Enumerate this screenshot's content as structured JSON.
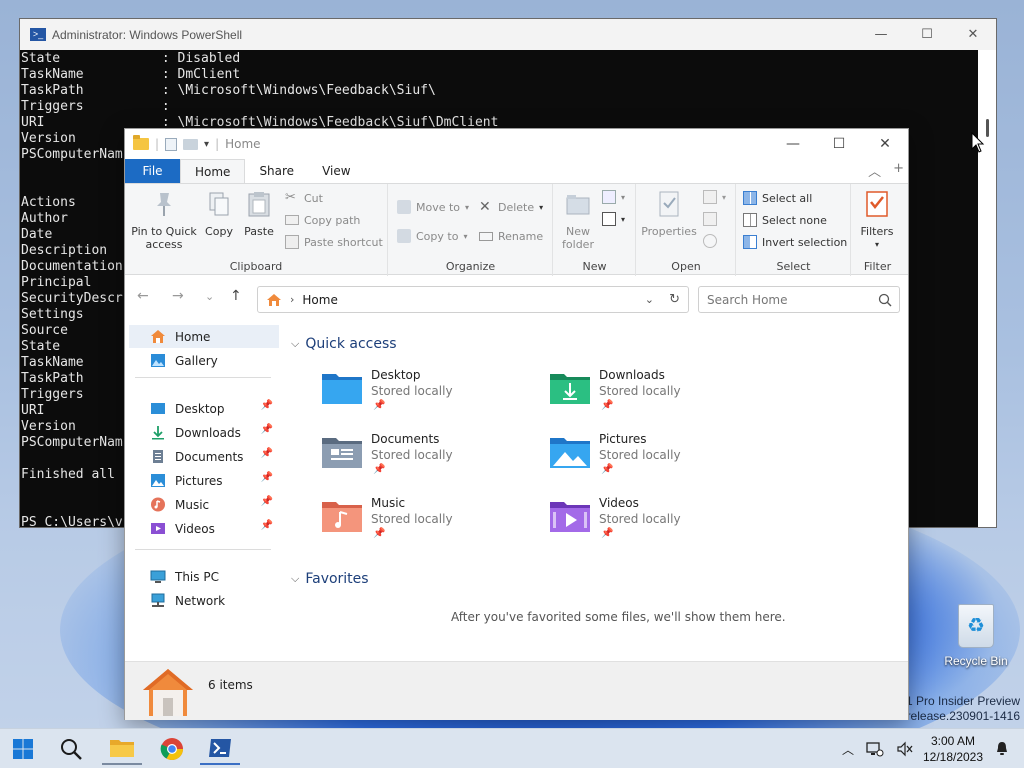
{
  "desktop": {
    "recycle_bin_label": "Recycle Bin",
    "watermark_line1": "1 Pro Insider Preview",
    "watermark_line2": "erelease.230901-1416"
  },
  "powershell": {
    "title": "Administrator: Windows PowerShell",
    "lines": [
      "State             : Disabled",
      "TaskName          : DmClient",
      "TaskPath          : \\Microsoft\\Windows\\Feedback\\Siuf\\",
      "Triggers          :",
      "URI               : \\Microsoft\\Windows\\Feedback\\Siuf\\DmClient",
      "Version",
      "PSComputerNam",
      "",
      "",
      "Actions",
      "Author",
      "Date",
      "Description",
      "Documentation",
      "Principal",
      "SecurityDescr",
      "Settings",
      "Source",
      "State",
      "TaskName",
      "TaskPath",
      "Triggers",
      "URI",
      "Version",
      "PSComputerNam",
      "",
      "Finished all",
      "",
      "",
      "PS C:\\Users\\v"
    ]
  },
  "explorer": {
    "title": "Home",
    "tabs": {
      "file": "File",
      "home": "Home",
      "share": "Share",
      "view": "View"
    },
    "ribbon": {
      "clipboard": {
        "label": "Clipboard",
        "pin": "Pin to Quick\naccess",
        "copy": "Copy",
        "paste": "Paste",
        "cut": "Cut",
        "copy_path": "Copy path",
        "paste_shortcut": "Paste shortcut"
      },
      "organize": {
        "label": "Organize",
        "move_to": "Move to",
        "copy_to": "Copy to",
        "delete": "Delete",
        "rename": "Rename"
      },
      "new": {
        "label": "New",
        "new_folder": "New\nfolder"
      },
      "open": {
        "label": "Open",
        "properties": "Properties"
      },
      "select": {
        "label": "Select",
        "select_all": "Select all",
        "select_none": "Select none",
        "invert": "Invert selection"
      },
      "filter": {
        "label": "Filter",
        "filters": "Filters"
      }
    },
    "address": "Home",
    "search_placeholder": "Search Home",
    "sidebar": {
      "home": "Home",
      "gallery": "Gallery",
      "desktop": "Desktop",
      "downloads": "Downloads",
      "documents": "Documents",
      "pictures": "Pictures",
      "music": "Music",
      "videos": "Videos",
      "this_pc": "This PC",
      "network": "Network"
    },
    "quick_access": {
      "heading": "Quick access",
      "items": [
        {
          "name": "Desktop",
          "sub": "Stored locally"
        },
        {
          "name": "Downloads",
          "sub": "Stored locally"
        },
        {
          "name": "Documents",
          "sub": "Stored locally"
        },
        {
          "name": "Pictures",
          "sub": "Stored locally"
        },
        {
          "name": "Music",
          "sub": "Stored locally"
        },
        {
          "name": "Videos",
          "sub": "Stored locally"
        }
      ]
    },
    "favorites": {
      "heading": "Favorites",
      "empty_message": "After you've favorited some files, we'll show them here."
    },
    "status": {
      "items": "6 items"
    }
  },
  "taskbar": {
    "time": "3:00 AM",
    "date": "12/18/2023"
  },
  "colors": {
    "accent": "#1c6bc4",
    "heading": "#1d3f7a"
  }
}
